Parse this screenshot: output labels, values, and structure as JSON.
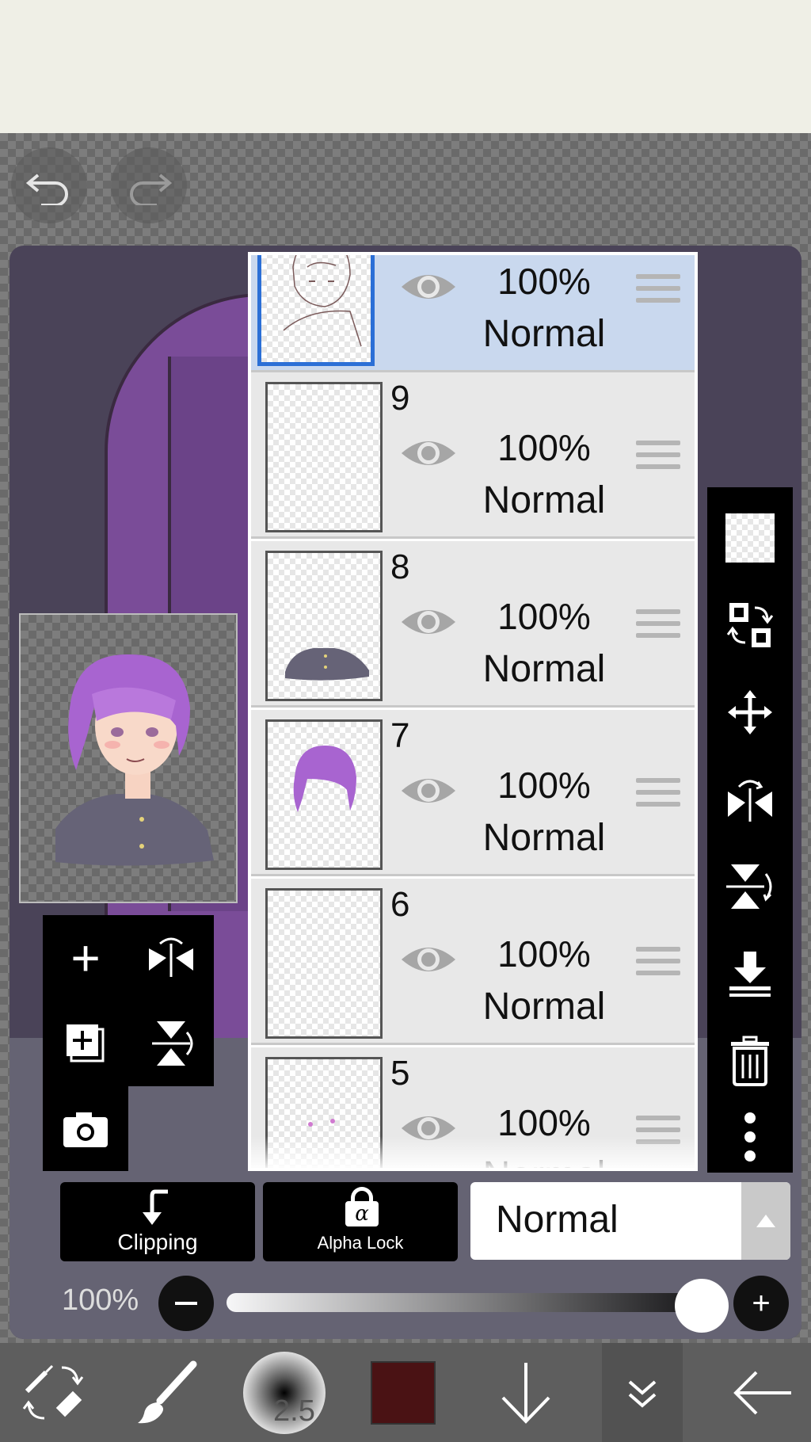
{
  "toolbar": {
    "undo_icon": "undo-icon",
    "redo_icon": "redo-icon"
  },
  "layers": [
    {
      "number": "",
      "opacity": "100%",
      "blend": "Normal",
      "selected": true
    },
    {
      "number": "9",
      "opacity": "100%",
      "blend": "Normal",
      "selected": false
    },
    {
      "number": "8",
      "opacity": "100%",
      "blend": "Normal",
      "selected": false
    },
    {
      "number": "7",
      "opacity": "100%",
      "blend": "Normal",
      "selected": false
    },
    {
      "number": "6",
      "opacity": "100%",
      "blend": "Normal",
      "selected": false
    },
    {
      "number": "5",
      "opacity": "100%",
      "blend": "Normal",
      "selected": false
    }
  ],
  "layer_panel": {
    "clipping_label": "Clipping",
    "alpha_lock_label": "Alpha Lock",
    "alpha_lock_glyph": "α",
    "blend_mode": "Normal",
    "opacity_label": "100%",
    "opacity_value": 1.0
  },
  "bottom_bar": {
    "brush_size": "2.5",
    "color": "#4a1214"
  },
  "colors": {
    "selected_layer_bg": "#c9d8ee",
    "selected_border": "#2b6fd6",
    "hair": "#a864d0"
  }
}
